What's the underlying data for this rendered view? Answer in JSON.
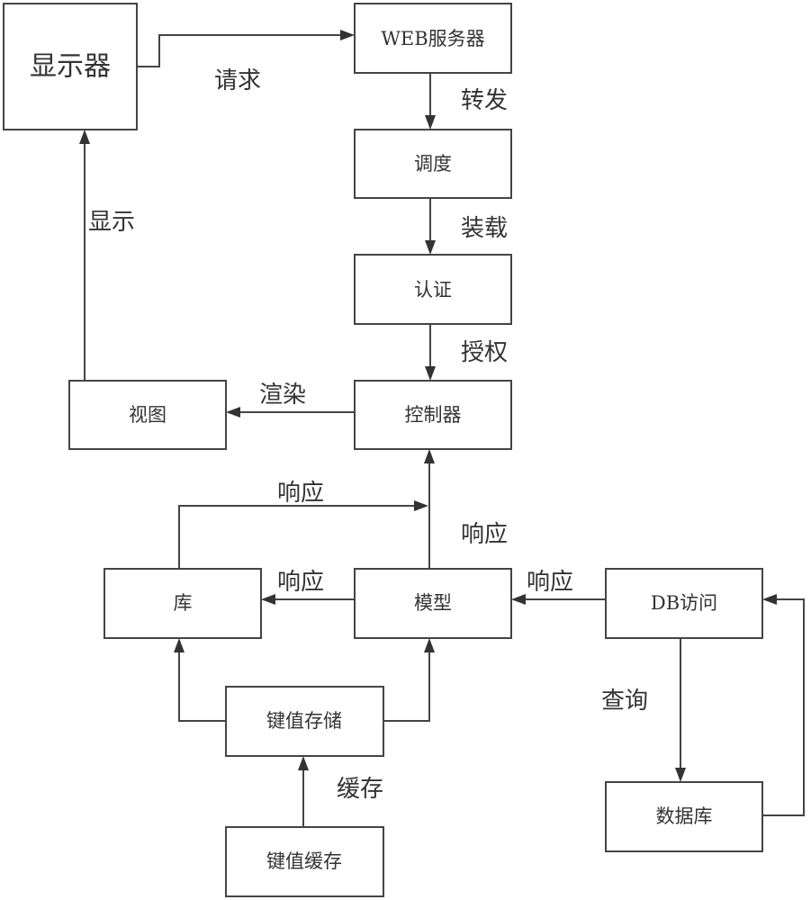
{
  "diagram": {
    "title": "",
    "nodes": [
      {
        "id": "display",
        "label": "显示器"
      },
      {
        "id": "web_server",
        "label": "WEB服务器"
      },
      {
        "id": "scheduler",
        "label": "调度"
      },
      {
        "id": "auth",
        "label": "认证"
      },
      {
        "id": "controller",
        "label": "控制器"
      },
      {
        "id": "view",
        "label": "视图"
      },
      {
        "id": "library",
        "label": "库"
      },
      {
        "id": "model",
        "label": "模型"
      },
      {
        "id": "db_access",
        "label": "DB访问"
      },
      {
        "id": "kv_store",
        "label": "键值存储"
      },
      {
        "id": "database",
        "label": "数据库"
      },
      {
        "id": "kv_cache",
        "label": "键值缓存"
      }
    ],
    "edges": [
      {
        "from": "display",
        "to": "web_server",
        "label": "请求"
      },
      {
        "from": "web_server",
        "to": "scheduler",
        "label": "转发"
      },
      {
        "from": "scheduler",
        "to": "auth",
        "label": "装载"
      },
      {
        "from": "auth",
        "to": "controller",
        "label": "授权"
      },
      {
        "from": "controller",
        "to": "view",
        "label": "渲染"
      },
      {
        "from": "view",
        "to": "display",
        "label": "显示"
      },
      {
        "from": "library",
        "to": "controller",
        "label": "响应"
      },
      {
        "from": "model",
        "to": "controller",
        "label": "响应"
      },
      {
        "from": "model",
        "to": "library",
        "label": "响应"
      },
      {
        "from": "db_access",
        "to": "model",
        "label": "响应"
      },
      {
        "from": "db_access",
        "to": "database",
        "label": "查询"
      },
      {
        "from": "database",
        "to": "db_access",
        "label": ""
      },
      {
        "from": "kv_store",
        "to": "library",
        "label": ""
      },
      {
        "from": "kv_store",
        "to": "model",
        "label": ""
      },
      {
        "from": "kv_cache",
        "to": "kv_store",
        "label": "缓存"
      }
    ]
  }
}
